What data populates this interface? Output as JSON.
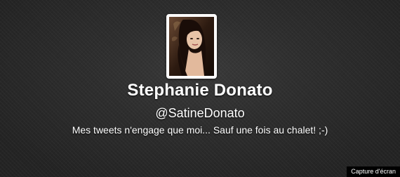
{
  "profile": {
    "full_name": "Stephanie Donato",
    "screen_name": "@SatineDonato",
    "bio": "Mes tweets n'engage que moi... Sauf une fois au chalet! ;-)"
  },
  "credit": {
    "label": "Capture d'écran"
  },
  "colors": {
    "background": "#2b2b2b",
    "text": "#ffffff",
    "avatar_border": "#ffffff"
  }
}
